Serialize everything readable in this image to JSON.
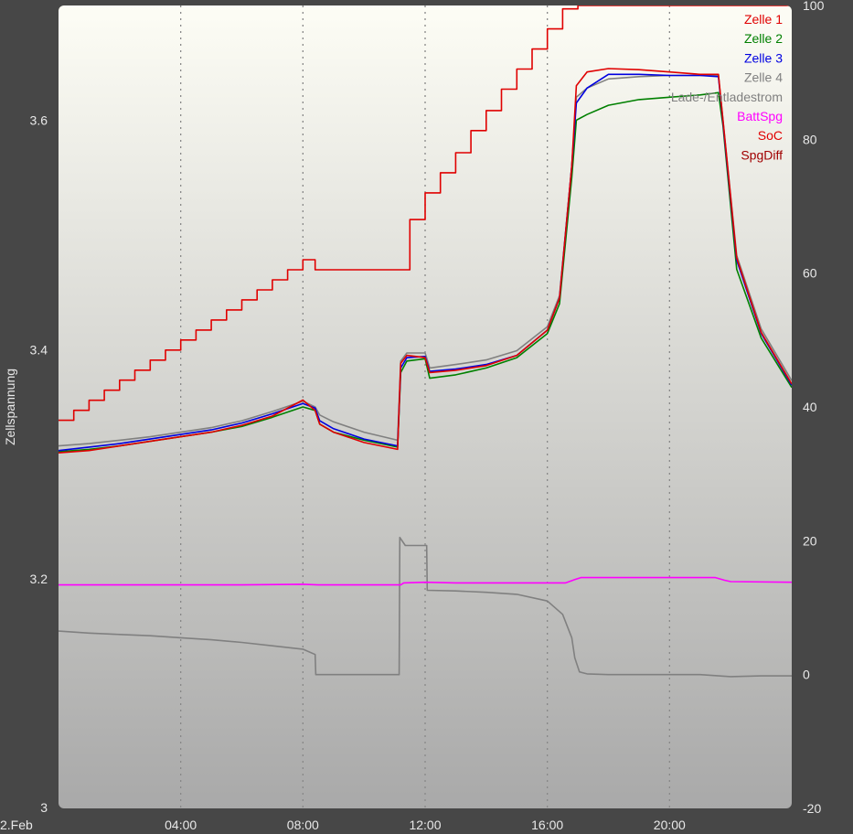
{
  "chart_data": {
    "type": "line",
    "title": "",
    "ylabel": "Zellspannung",
    "xlabel": "",
    "x_start_label": "2.Feb",
    "x_unit": "hours",
    "xlim": [
      0,
      24
    ],
    "x_ticks": [
      {
        "x": 4,
        "label": "04:00"
      },
      {
        "x": 8,
        "label": "08:00"
      },
      {
        "x": 12,
        "label": "12:00"
      },
      {
        "x": 16,
        "label": "16:00"
      },
      {
        "x": 20,
        "label": "20:00"
      }
    ],
    "ylim": [
      3.0,
      3.7
    ],
    "y_ticks": [
      3,
      3.2,
      3.4,
      3.6
    ],
    "y_tick_labels": [
      "3",
      "3.2",
      "3.4",
      "3.6"
    ],
    "y2lim": [
      -20,
      100
    ],
    "y2_ticks": [
      -20,
      0,
      20,
      40,
      60,
      80,
      100
    ],
    "y2_tick_labels": [
      "-20",
      "0",
      "20",
      "40",
      "60",
      "80",
      "100"
    ],
    "grid_x": true,
    "grid_y": false,
    "legend_position": "top-right",
    "colors": {
      "background_top": "#fdfdf5",
      "background_bottom": "#a9a9a9",
      "outer": "#474747",
      "grid": "#888888"
    },
    "series": [
      {
        "name": "Zelle 1",
        "color": "#e00000",
        "axis": "left",
        "x": [
          0,
          1,
          2,
          3,
          4,
          5,
          6,
          7,
          8,
          8.4,
          8.55,
          9,
          10,
          11.1,
          11.2,
          11.4,
          12.0,
          12.15,
          13,
          14,
          15,
          16,
          16.4,
          16.8,
          16.95,
          17.3,
          18,
          19,
          20,
          21,
          21.6,
          21.75,
          22.2,
          23,
          24
        ],
        "y": [
          3.31,
          3.312,
          3.316,
          3.32,
          3.324,
          3.328,
          3.334,
          3.342,
          3.356,
          3.347,
          3.335,
          3.328,
          3.319,
          3.313,
          3.388,
          3.395,
          3.393,
          3.38,
          3.382,
          3.386,
          3.395,
          3.417,
          3.445,
          3.56,
          3.63,
          3.642,
          3.645,
          3.644,
          3.642,
          3.64,
          3.64,
          3.6,
          3.48,
          3.415,
          3.37
        ]
      },
      {
        "name": "Zelle 2",
        "color": "#008000",
        "axis": "left",
        "x": [
          0,
          1,
          2,
          3,
          4,
          5,
          6,
          7,
          8,
          8.4,
          8.55,
          9,
          10,
          11.1,
          11.2,
          11.4,
          12.0,
          12.15,
          13,
          14,
          15,
          16,
          16.4,
          16.8,
          16.95,
          17.3,
          18,
          19,
          20,
          21,
          21.6,
          21.75,
          22.2,
          23,
          24
        ],
        "y": [
          3.311,
          3.313,
          3.316,
          3.32,
          3.324,
          3.328,
          3.333,
          3.341,
          3.35,
          3.347,
          3.335,
          3.328,
          3.321,
          3.315,
          3.38,
          3.39,
          3.392,
          3.375,
          3.378,
          3.384,
          3.393,
          3.414,
          3.44,
          3.55,
          3.6,
          3.605,
          3.613,
          3.618,
          3.62,
          3.622,
          3.624,
          3.595,
          3.47,
          3.41,
          3.367
        ]
      },
      {
        "name": "Zelle 3",
        "color": "#0000e0",
        "axis": "left",
        "x": [
          0,
          1,
          2,
          3,
          4,
          5,
          6,
          7,
          8,
          8.4,
          8.55,
          9,
          10,
          11.1,
          11.2,
          11.4,
          12.0,
          12.15,
          13,
          14,
          15,
          16,
          16.4,
          16.8,
          16.95,
          17.3,
          18,
          19,
          20,
          21,
          21.6,
          21.75,
          22.2,
          23,
          24
        ],
        "y": [
          3.312,
          3.315,
          3.318,
          3.322,
          3.326,
          3.33,
          3.336,
          3.344,
          3.353,
          3.349,
          3.338,
          3.331,
          3.322,
          3.316,
          3.384,
          3.393,
          3.394,
          3.381,
          3.383,
          3.387,
          3.395,
          3.417,
          3.445,
          3.56,
          3.615,
          3.628,
          3.64,
          3.64,
          3.639,
          3.639,
          3.638,
          3.598,
          3.478,
          3.414,
          3.369
        ]
      },
      {
        "name": "Zelle 4",
        "color": "#808080",
        "axis": "left",
        "x": [
          0,
          1,
          2,
          3,
          4,
          5,
          6,
          7,
          8,
          8.4,
          8.55,
          9,
          10,
          11.1,
          11.2,
          11.4,
          12.0,
          12.15,
          13,
          14,
          15,
          16,
          16.4,
          16.8,
          16.95,
          17.3,
          18,
          19,
          20,
          21,
          21.6,
          21.75,
          22.2,
          23,
          24
        ],
        "y": [
          3.316,
          3.318,
          3.321,
          3.324,
          3.328,
          3.332,
          3.338,
          3.346,
          3.355,
          3.35,
          3.343,
          3.337,
          3.328,
          3.321,
          3.39,
          3.397,
          3.397,
          3.384,
          3.387,
          3.391,
          3.399,
          3.42,
          3.447,
          3.56,
          3.62,
          3.628,
          3.636,
          3.638,
          3.639,
          3.639,
          3.639,
          3.6,
          3.482,
          3.418,
          3.373
        ]
      },
      {
        "name": "Lade-/Entladestrom",
        "color": "#808080",
        "axis": "right",
        "x": [
          0,
          1,
          2,
          3,
          4,
          5,
          6,
          7,
          8,
          8.4,
          8.42,
          10,
          11.15,
          11.17,
          11.35,
          12.05,
          12.07,
          13,
          14,
          15,
          16,
          16.5,
          16.8,
          16.9,
          17.05,
          17.3,
          18,
          19,
          20,
          21,
          22,
          23,
          24
        ],
        "y": [
          6.5,
          6.2,
          6.0,
          5.8,
          5.5,
          5.2,
          4.8,
          4.3,
          3.8,
          3.0,
          0.0,
          0.0,
          0.0,
          20.5,
          19.3,
          19.3,
          12.6,
          12.5,
          12.3,
          12.0,
          11.0,
          9.0,
          5.5,
          2.5,
          0.4,
          0.1,
          0.0,
          0.0,
          0.0,
          0.0,
          -0.3,
          -0.2,
          -0.2
        ]
      },
      {
        "name": "BattSpg",
        "color": "#ff00ff",
        "axis": "right",
        "x": [
          0,
          2,
          4,
          6,
          8,
          8.5,
          10,
          11.2,
          11.3,
          12,
          13,
          14,
          15,
          16,
          16.6,
          16.9,
          17.1,
          20,
          21.5,
          21.8,
          22,
          24
        ],
        "y": [
          13.4,
          13.4,
          13.4,
          13.4,
          13.5,
          13.4,
          13.4,
          13.4,
          13.7,
          13.8,
          13.7,
          13.7,
          13.7,
          13.7,
          13.7,
          14.2,
          14.5,
          14.5,
          14.5,
          14.1,
          13.9,
          13.8
        ]
      },
      {
        "name": "SoC",
        "color": "#e00000",
        "axis": "right",
        "step": true,
        "x": [
          0,
          0.5,
          1,
          1.5,
          2,
          2.5,
          3,
          3.5,
          4,
          4.5,
          5,
          5.5,
          6,
          6.5,
          7,
          7.5,
          8,
          8.4,
          11.2,
          11.5,
          12,
          12.5,
          13,
          13.5,
          14,
          14.5,
          15,
          15.5,
          16,
          16.5,
          17.0,
          17.5,
          24
        ],
        "y": [
          38,
          39.5,
          41,
          42.5,
          44,
          45.5,
          47,
          48.5,
          50,
          51.5,
          53,
          54.5,
          56,
          57.5,
          59,
          60.5,
          62,
          60.5,
          60.5,
          68,
          72,
          75,
          78,
          81.3,
          84.3,
          87.5,
          90.5,
          93.5,
          96.5,
          99.5,
          100,
          100,
          100
        ]
      },
      {
        "name": "SpgDiff",
        "color": "#a00000",
        "axis": "right",
        "x": [],
        "y": []
      }
    ]
  }
}
